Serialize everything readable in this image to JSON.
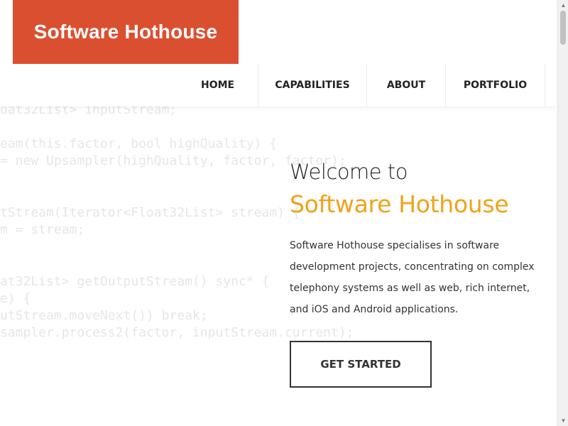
{
  "site": {
    "logo_text": "Software Hothouse"
  },
  "nav": {
    "items": [
      {
        "label": "HOME"
      },
      {
        "label": "CAPABILITIES"
      },
      {
        "label": "ABOUT"
      },
      {
        "label": "PORTFOLIO"
      }
    ]
  },
  "hero": {
    "welcome": "Welcome to",
    "brand": "Software Hothouse",
    "description": "Software Hothouse specialises in software development projects, concentrating on complex telephony systems as well as web, rich internet, and iOS and Android applications.",
    "cta_label": "GET STARTED"
  },
  "background_code": {
    "lines": [
      "oat32List> inputStream;",
      "eam(this.factor, bool highQuality) {",
      "= new Upsampler(highQuality, factor, factor);",
      "tStream(Iterator<Float32List> stream) {",
      "m = stream;",
      "at32List> getOutputStream() sync* {",
      "e) {",
      "utStream.moveNext()) break;",
      "sampler.process2(factor, inputStream.current);"
    ]
  },
  "colors": {
    "logo_bg": "#db4f31",
    "brand_accent": "#efa21a",
    "text_dark": "#222222"
  },
  "icons": {
    "scroll_up": "triangle-up",
    "scroll_down": "triangle-down"
  }
}
